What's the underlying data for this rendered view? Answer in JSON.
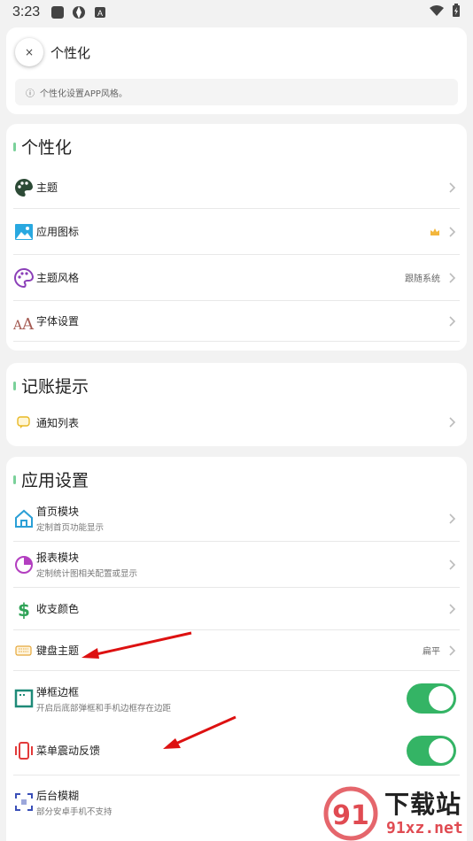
{
  "status": {
    "time": "3:23"
  },
  "header": {
    "close_label": "×",
    "title": "个性化",
    "info_icon": "ⓘ",
    "info_text": "个性化设置APP风格。"
  },
  "sections": [
    {
      "title": "个性化",
      "items": [
        {
          "label": "主题",
          "icon": "palette-dark-icon"
        },
        {
          "label": "应用图标",
          "icon": "image-icon",
          "badge": "crown-icon"
        },
        {
          "label": "主题风格",
          "icon": "palette-purple-icon",
          "value": "跟随系统"
        },
        {
          "label": "字体设置",
          "icon": "font-size-icon"
        }
      ]
    },
    {
      "title": "记账提示",
      "items": [
        {
          "label": "通知列表",
          "icon": "chat-bubble-icon"
        }
      ]
    },
    {
      "title": "应用设置",
      "items": [
        {
          "label": "首页模块",
          "sub": "定制首页功能显示",
          "icon": "home-icon"
        },
        {
          "label": "报表模块",
          "sub": "定制统计图相关配置或显示",
          "icon": "pie-chart-icon"
        },
        {
          "label": "收支颜色",
          "icon": "dollar-icon"
        },
        {
          "label": "键盘主题",
          "icon": "keyboard-icon",
          "value": "扁平"
        },
        {
          "label": "弹框边框",
          "sub": "开启后底部弹框和手机边框存在边距",
          "icon": "frame-icon",
          "toggle": true
        },
        {
          "label": "菜单震动反馈",
          "icon": "vibrate-icon",
          "toggle": true
        },
        {
          "label": "后台模糊",
          "sub": "部分安卓手机不支持",
          "icon": "blur-icon"
        }
      ]
    }
  ],
  "watermark": {
    "brand": "下载站",
    "domain": "91xz.net"
  },
  "colors": {
    "accent_green": "#34b465",
    "section_bar": "#7ad19a",
    "arrow_red": "#d11"
  }
}
